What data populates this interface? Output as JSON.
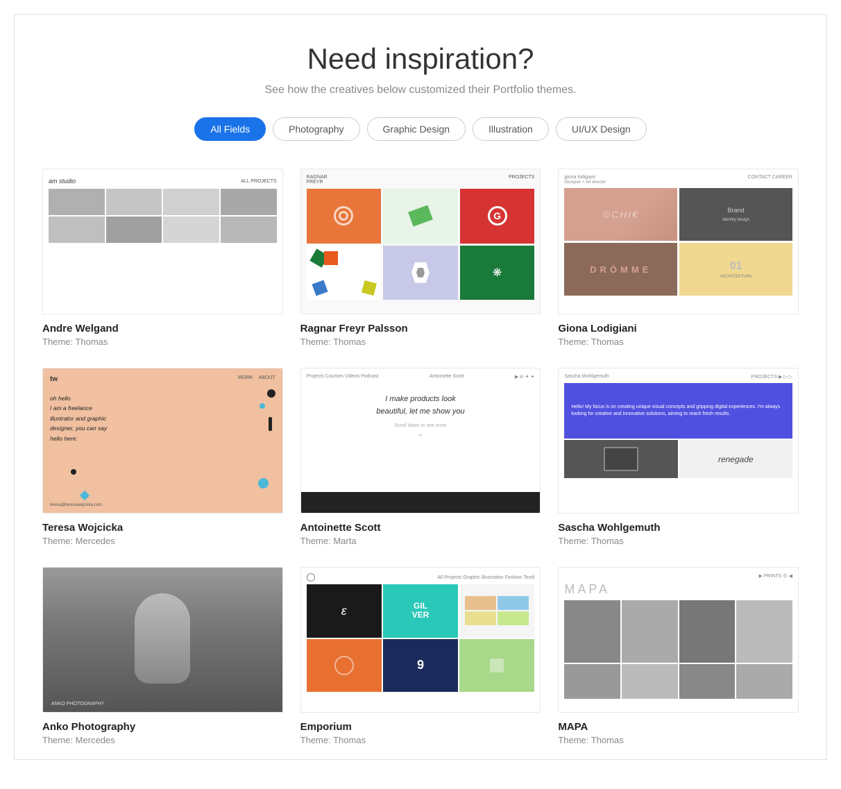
{
  "hero": {
    "title": "Need inspiration?",
    "subtitle": "See how the creatives below customized their Portfolio themes."
  },
  "filters": {
    "tabs": [
      {
        "id": "all",
        "label": "All Fields",
        "active": true
      },
      {
        "id": "photography",
        "label": "Photography",
        "active": false
      },
      {
        "id": "graphic-design",
        "label": "Graphic Design",
        "active": false
      },
      {
        "id": "illustration",
        "label": "Illustration",
        "active": false
      },
      {
        "id": "ui-ux",
        "label": "UI/UX Design",
        "active": false
      }
    ]
  },
  "portfolios": [
    {
      "id": "andre",
      "name": "Andre Welgand",
      "theme": "Theme: Thomas"
    },
    {
      "id": "ragnar",
      "name": "Ragnar Freyr Palsson",
      "theme": "Theme: Thomas"
    },
    {
      "id": "giona",
      "name": "Giona Lodigiani",
      "theme": "Theme: Thomas"
    },
    {
      "id": "teresa",
      "name": "Teresa Wojcicka",
      "theme": "Theme: Mercedes"
    },
    {
      "id": "antoinette",
      "name": "Antoinette Scott",
      "theme": "Theme: Marta"
    },
    {
      "id": "sascha",
      "name": "Sascha Wohlgemuth",
      "theme": "Theme: Thomas"
    },
    {
      "id": "anko",
      "name": "Anko Photography",
      "theme": "Theme: Mercedes"
    },
    {
      "id": "emporium",
      "name": "Emporium",
      "theme": "Theme: Thomas"
    },
    {
      "id": "mapa",
      "name": "MAPA",
      "theme": "Theme: Thomas"
    }
  ]
}
